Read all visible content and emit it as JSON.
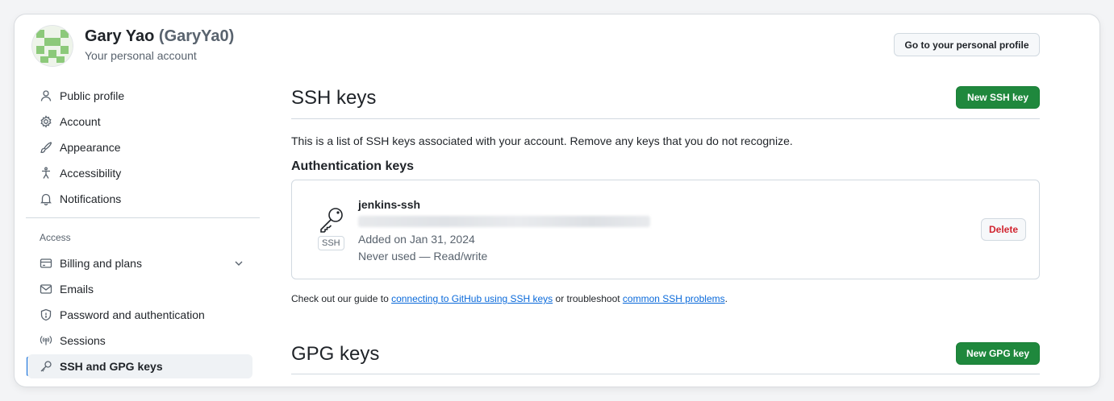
{
  "header": {
    "user_name": "Gary Yao",
    "user_login": "(GaryYa0)",
    "account_subtitle": "Your personal account",
    "profile_button": "Go to your personal profile"
  },
  "sidebar": {
    "items": [
      {
        "label": "Public profile",
        "icon": "person-icon"
      },
      {
        "label": "Account",
        "icon": "gear-icon"
      },
      {
        "label": "Appearance",
        "icon": "paintbrush-icon"
      },
      {
        "label": "Accessibility",
        "icon": "accessibility-icon"
      },
      {
        "label": "Notifications",
        "icon": "bell-icon"
      }
    ],
    "access_label": "Access",
    "access_items": [
      {
        "label": "Billing and plans",
        "icon": "credit-card-icon"
      },
      {
        "label": "Emails",
        "icon": "mail-icon"
      },
      {
        "label": "Password and authentication",
        "icon": "shield-lock-icon"
      },
      {
        "label": "Sessions",
        "icon": "broadcast-icon"
      },
      {
        "label": "SSH and GPG keys",
        "icon": "key-icon"
      }
    ],
    "active_item": "SSH and GPG keys"
  },
  "ssh": {
    "title": "SSH keys",
    "new_button": "New SSH key",
    "description": "This is a list of SSH keys associated with your account. Remove any keys that you do not recognize.",
    "auth_heading": "Authentication keys",
    "keys": [
      {
        "title": "jenkins-ssh",
        "badge": "SSH",
        "added": "Added on Jan 31, 2024",
        "usage": "Never used — Read/write",
        "delete_label": "Delete"
      }
    ],
    "guide": {
      "prefix": "Check out our guide to ",
      "link1": "connecting to GitHub using SSH keys",
      "middle": " or troubleshoot ",
      "link2": "common SSH problems",
      "suffix": "."
    }
  },
  "gpg": {
    "title": "GPG keys",
    "new_button": "New GPG key"
  },
  "colors": {
    "primary_green": "#1f883d",
    "link_blue": "#0969da",
    "danger_red": "#d1242f",
    "active_bar": "#0969da"
  }
}
